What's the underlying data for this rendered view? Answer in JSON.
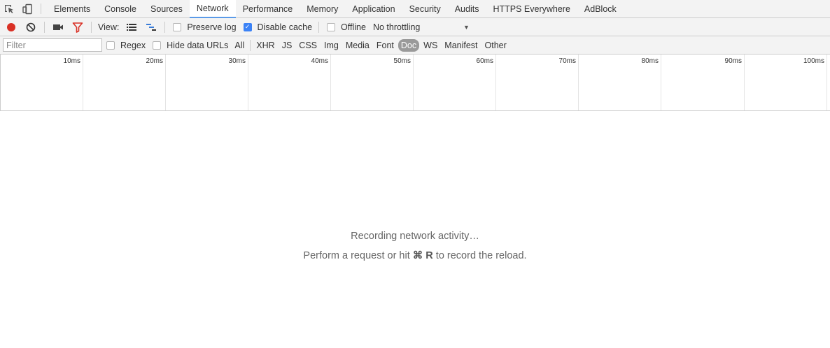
{
  "tabbar": {
    "tabs": [
      {
        "label": "Elements"
      },
      {
        "label": "Console"
      },
      {
        "label": "Sources"
      },
      {
        "label": "Network"
      },
      {
        "label": "Performance"
      },
      {
        "label": "Memory"
      },
      {
        "label": "Application"
      },
      {
        "label": "Security"
      },
      {
        "label": "Audits"
      },
      {
        "label": "HTTPS Everywhere"
      },
      {
        "label": "AdBlock"
      }
    ],
    "active_tab": "Network"
  },
  "toolbar": {
    "view_label": "View:",
    "preserve_log_label": "Preserve log",
    "preserve_log_checked": false,
    "disable_cache_label": "Disable cache",
    "disable_cache_checked": true,
    "offline_label": "Offline",
    "offline_checked": false,
    "throttling_value": "No throttling",
    "record_color": "#d93025",
    "filter_icon_color": "#d93025"
  },
  "filterbar": {
    "filter_placeholder": "Filter",
    "regex_label": "Regex",
    "hide_data_urls_label": "Hide data URLs",
    "types": [
      "All",
      "XHR",
      "JS",
      "CSS",
      "Img",
      "Media",
      "Font",
      "Doc",
      "WS",
      "Manifest",
      "Other"
    ],
    "active_type": "Doc"
  },
  "timeline": {
    "ticks": [
      "10ms",
      "20ms",
      "30ms",
      "40ms",
      "50ms",
      "60ms",
      "70ms",
      "80ms",
      "90ms",
      "100ms"
    ]
  },
  "empty_state": {
    "title": "Recording network activity…",
    "hint_before": "Perform a request or hit ",
    "hint_key": "⌘ R",
    "hint_after": " to record the reload."
  }
}
